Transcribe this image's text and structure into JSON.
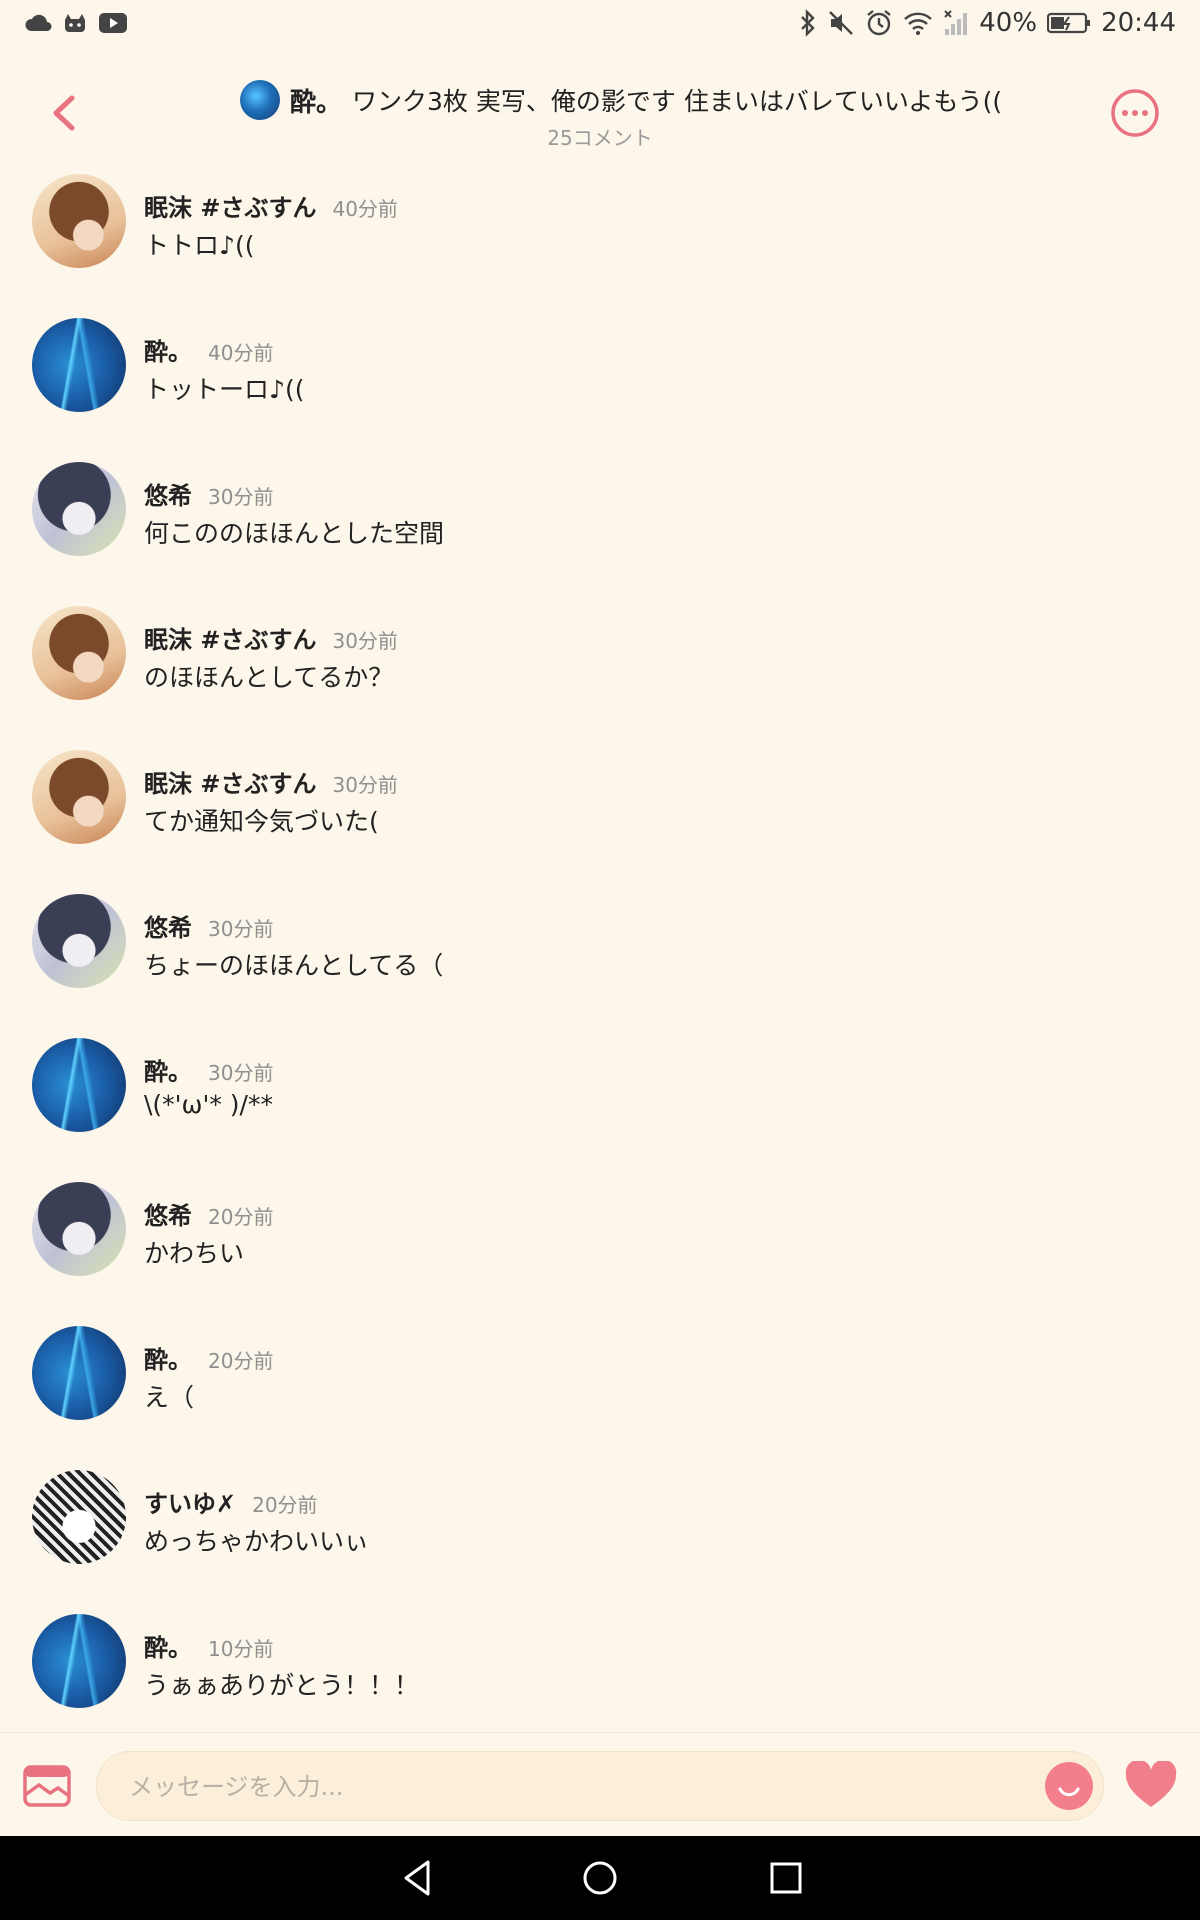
{
  "status_bar": {
    "battery": "40%",
    "time": "20:44",
    "left_icons": [
      "cloud-icon",
      "cat-icon",
      "youtube-icon"
    ],
    "right_icons": [
      "bluetooth-icon",
      "mute-icon",
      "alarm-icon",
      "wifi-icon",
      "signal-icon",
      "battery-icon"
    ]
  },
  "header": {
    "author_name": "酔。",
    "post_title": "ワンク3枚 実写、俺の影です 住まいはバレていいよもう((",
    "comment_count": "25コメント"
  },
  "comments": [
    {
      "name": "眠沫 #さぶすん",
      "time": "40分前",
      "text": "トトロ♪((",
      "avatar": "girl"
    },
    {
      "name": "酔。",
      "time": "40分前",
      "text": "トットーロ♪((",
      "avatar": "blue"
    },
    {
      "name": "悠希",
      "time": "30分前",
      "text": "何こののほほんとした空間",
      "avatar": "dark"
    },
    {
      "name": "眠沫 #さぶすん",
      "time": "30分前",
      "text": "のほほんとしてるか？",
      "avatar": "girl"
    },
    {
      "name": "眠沫 #さぶすん",
      "time": "30分前",
      "text": "てか通知今気づいた(",
      "avatar": "girl"
    },
    {
      "name": "悠希",
      "time": "30分前",
      "text": "ちょーのほほんとしてる（",
      "avatar": "dark"
    },
    {
      "name": "酔。",
      "time": "30分前",
      "text": "\\(*'ω'* )/**",
      "avatar": "blue"
    },
    {
      "name": "悠希",
      "time": "20分前",
      "text": "かわちい",
      "avatar": "dark"
    },
    {
      "name": "酔。",
      "time": "20分前",
      "text": "え（",
      "avatar": "blue"
    },
    {
      "name": "すいゆ✗",
      "time": "20分前",
      "text": "めっちゃかわいいぃ",
      "avatar": "manga"
    },
    {
      "name": "酔。",
      "time": "10分前",
      "text": "うぁぁありがとう！！！",
      "avatar": "blue"
    }
  ],
  "input_bar": {
    "placeholder": "メッセージを入力..."
  },
  "colors": {
    "background": "#fdf6ea",
    "accent": "#f47f8c"
  }
}
